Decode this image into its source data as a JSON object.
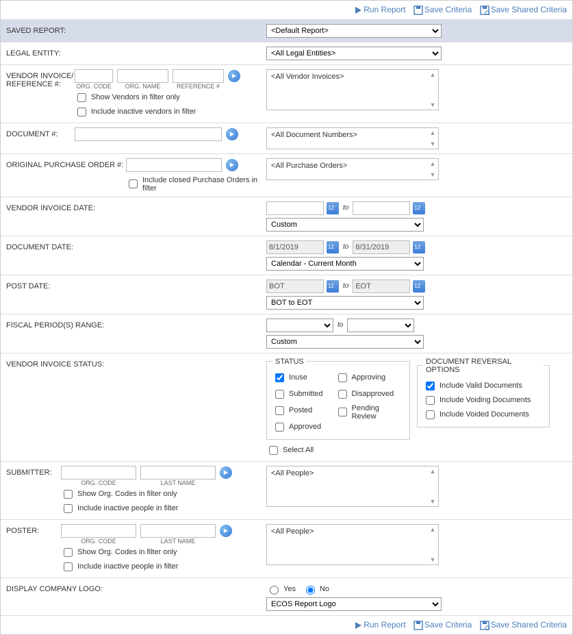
{
  "toolbar": {
    "run": "Run Report",
    "save": "Save Criteria",
    "saveShared": "Save Shared Criteria"
  },
  "labels": {
    "savedReport": "SAVED REPORT:",
    "legalEntity": "LEGAL ENTITY:",
    "vendorInvoiceRef": "VENDOR INVOICE/ REFERENCE #:",
    "documentNum": "DOCUMENT #:",
    "origPO": "ORIGINAL PURCHASE ORDER #:",
    "vendorInvoiceDate": "VENDOR INVOICE DATE:",
    "documentDate": "DOCUMENT DATE:",
    "postDate": "POST DATE:",
    "fiscalPeriod": "FISCAL PERIOD(S) RANGE:",
    "vendorInvoiceStatus": "VENDOR INVOICE STATUS:",
    "submitter": "SUBMITTER:",
    "poster": "POSTER:",
    "displayLogo": "DISPLAY COMPANY LOGO:"
  },
  "savedReport": {
    "selected": "<Default Report>"
  },
  "legalEntity": {
    "selected": "<All Legal Entities>"
  },
  "vendorRef": {
    "orgCodeCap": "ORG. CODE",
    "orgNameCap": "ORG. NAME",
    "refCap": "REFERENCE #",
    "chk1": "Show Vendors in filter only",
    "chk2": "Include inactive vendors in filter",
    "listbox": "<All Vendor Invoices>"
  },
  "documentNum": {
    "listbox": "<All Document Numbers>"
  },
  "origPO": {
    "chk": "Include closed Purchase Orders in filter",
    "listbox": "<All Purchase Orders>"
  },
  "vendorInvoiceDate": {
    "select": "Custom",
    "to": "to"
  },
  "documentDate": {
    "from": "8/1/2019",
    "to": "8/31/2019",
    "select": "Calendar - Current Month",
    "toLabel": "to"
  },
  "postDate": {
    "from": "BOT",
    "to": "EOT",
    "select": "BOT to EOT",
    "toLabel": "to"
  },
  "fiscalPeriod": {
    "select": "Custom",
    "toLabel": "to"
  },
  "status": {
    "legend": "STATUS",
    "options": {
      "inuse": "Inuse",
      "submitted": "Submitted",
      "posted": "Posted",
      "approved": "Approved",
      "approving": "Approving",
      "disapproved": "Disapproved",
      "pending": "Pending Review"
    },
    "selectAll": "Select All"
  },
  "reversal": {
    "legend": "DOCUMENT REVERSAL OPTIONS",
    "valid": "Include Valid Documents",
    "voiding": "Include Voiding Documents",
    "voided": "Include Voided Documents"
  },
  "submitter": {
    "orgCodeCap": "ORG. CODE",
    "lastNameCap": "LAST NAME",
    "chk1": "Show Org. Codes in filter only",
    "chk2": "Include inactive people in filter",
    "listbox": "<All People>"
  },
  "poster": {
    "orgCodeCap": "ORG. CODE",
    "lastNameCap": "LAST NAME",
    "chk1": "Show Org. Codes in filter only",
    "chk2": "Include inactive people in filter",
    "listbox": "<All People>"
  },
  "logo": {
    "yes": "Yes",
    "no": "No",
    "select": "ECOS Report Logo"
  }
}
